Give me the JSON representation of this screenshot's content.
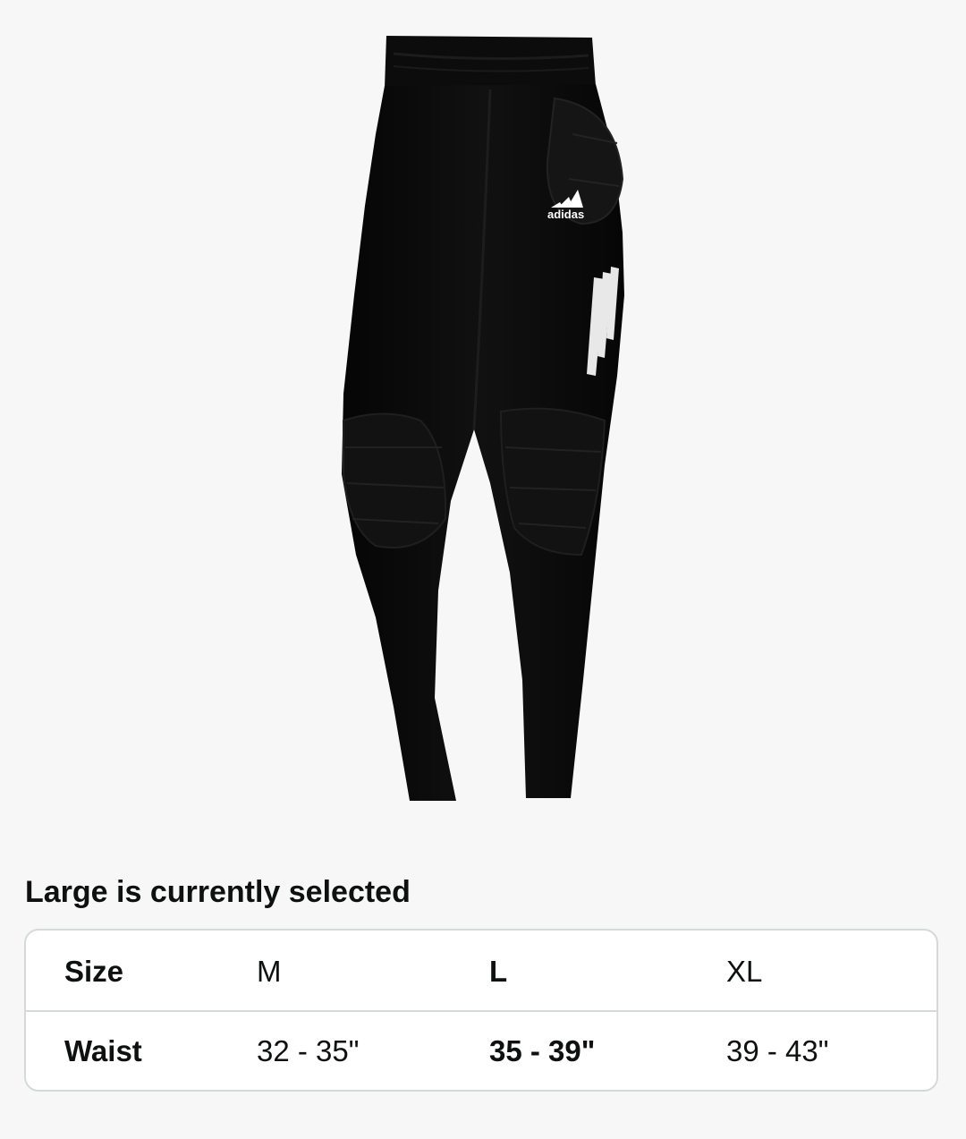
{
  "selection": {
    "label": "Large is currently selected"
  },
  "product_image": {
    "icon": "product-photo-pants",
    "logo_text": "adidas",
    "colors": {
      "garment": "#0a0a0a",
      "stripes": "#e8e8e8",
      "background": "#f7f7f7"
    }
  },
  "size_table": {
    "rows": [
      {
        "header": "Size",
        "values": [
          "M",
          "L",
          "XL"
        ]
      },
      {
        "header": "Waist",
        "values": [
          "32 - 35\"",
          "35 - 39\"",
          "39 - 43\""
        ]
      }
    ],
    "selected_column": "L"
  }
}
